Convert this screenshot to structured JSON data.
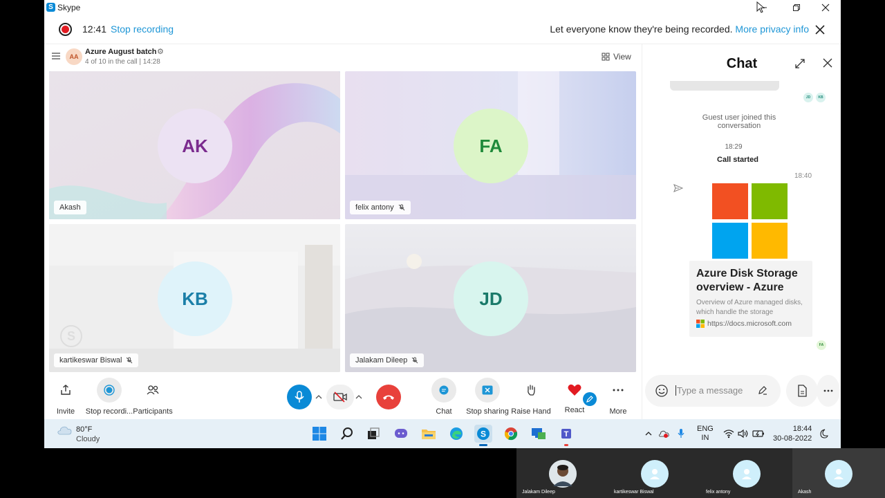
{
  "window": {
    "app_title": "Skype"
  },
  "recording": {
    "time": "12:41",
    "stop_label": "Stop recording",
    "notice": "Let everyone know they're being recorded.",
    "privacy_link": "More privacy info"
  },
  "call": {
    "avatar": "AA",
    "name": "Azure August batch",
    "status": "4 of 10 in the call | 14:28",
    "view_label": "View"
  },
  "participants": [
    {
      "initials": "AK",
      "name": "Akash",
      "muted": false,
      "selected": true,
      "color": "#7b2b8e"
    },
    {
      "initials": "FA",
      "name": "felix antony",
      "muted": true,
      "selected": false,
      "color": "#1f8a3a"
    },
    {
      "initials": "KB",
      "name": "kartikeswar Biswal",
      "muted": true,
      "selected": false,
      "color": "#1b7fa8"
    },
    {
      "initials": "JD",
      "name": "Jalakam Dileep",
      "muted": true,
      "selected": false,
      "color": "#1a7a6a"
    }
  ],
  "controls": {
    "invite": "Invite",
    "stop_recording": "Stop recordi...",
    "participants": "Participants",
    "chat": "Chat",
    "stop_sharing": "Stop sharing",
    "raise_hand": "Raise Hand",
    "react": "React",
    "more": "More"
  },
  "chat": {
    "title": "Chat",
    "read_avatars": [
      "JD",
      "KB"
    ],
    "guest_joined": "Guest user joined this conversation",
    "call_time": "18:29",
    "call_started": "Call started",
    "msg_time": "18:40",
    "card": {
      "title": "Azure Disk Storage overview - Azure",
      "description": "Overview of Azure managed disks, which handle the storage",
      "url": "https://docs.microsoft.com"
    },
    "seen_by": "FA",
    "placeholder": "Type a message"
  },
  "taskbar": {
    "temp": "80°F",
    "condition": "Cloudy",
    "lang": "ENG",
    "region": "IN",
    "time": "18:44",
    "date": "30-08-2022"
  },
  "strip": [
    {
      "name": "Jalakam Dileep"
    },
    {
      "name": "kartikeswar Biswal"
    },
    {
      "name": "felix antony"
    },
    {
      "name": "Akash"
    }
  ],
  "colors": {
    "accent": "#1e96d6",
    "record_red": "#e21b22",
    "hangup": "#e8413b",
    "ms_red": "#f25022",
    "ms_green": "#7fba00",
    "ms_blue": "#00a4ef",
    "ms_yellow": "#ffb900"
  }
}
